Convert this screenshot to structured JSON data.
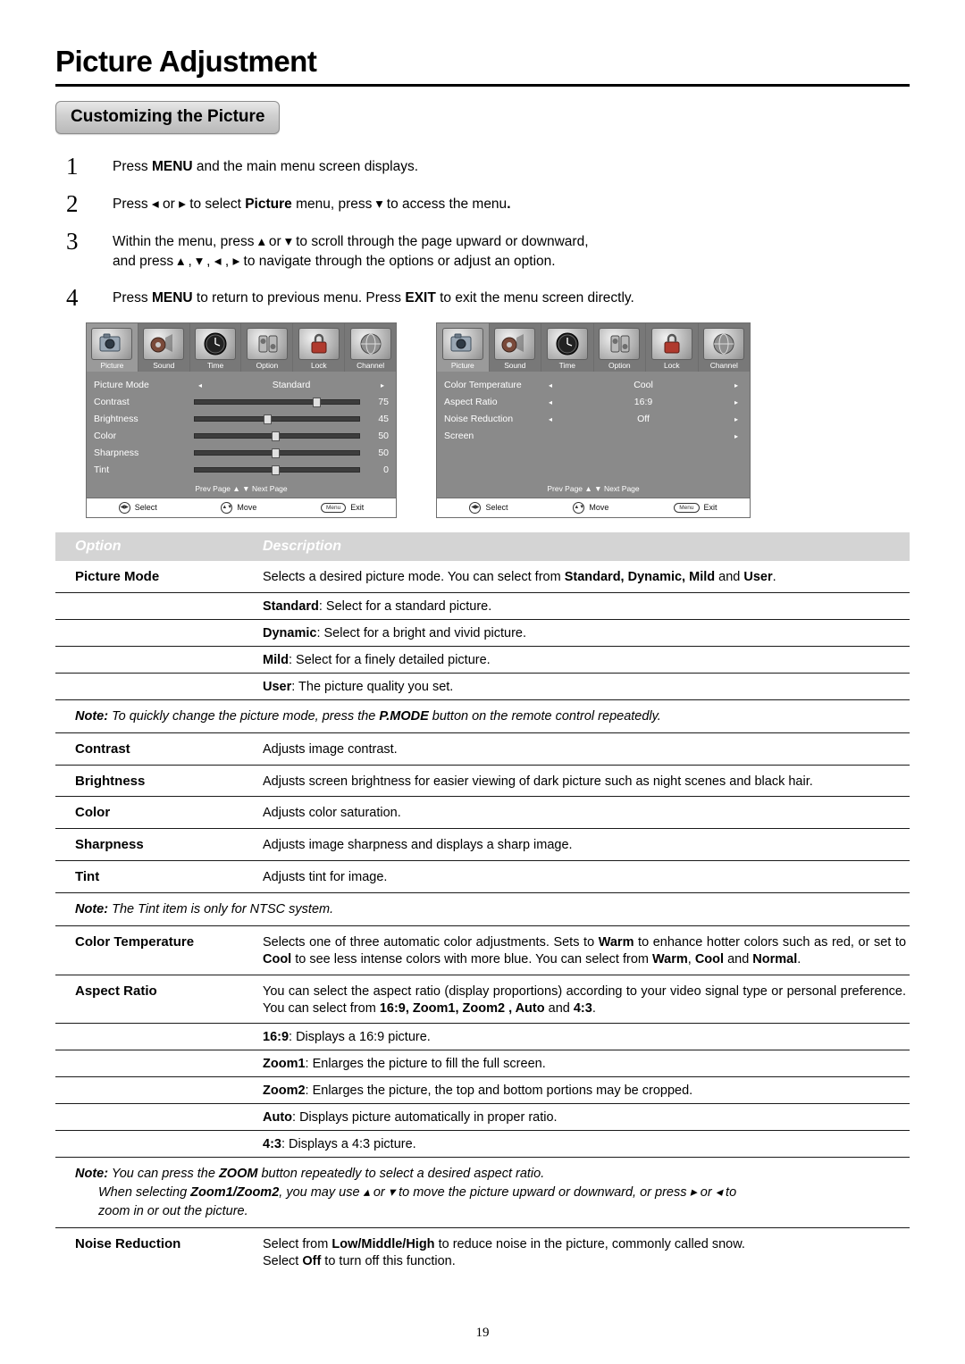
{
  "page": {
    "title": "Picture Adjustment",
    "section": "Customizing the Picture",
    "number": "19"
  },
  "steps": [
    {
      "num": "1",
      "html": "Press <b>MENU</b> and the main menu screen displays."
    },
    {
      "num": "2",
      "html": "Press ◂ or ▸ to select <b>Picture</b> menu,  press ▾ to access the menu<b>.</b>"
    },
    {
      "num": "3",
      "html": "Within the menu, press ▴ or ▾ to scroll through the page upward or downward,<br>and press ▴ , ▾ , ◂ , ▸ to navigate through the options or adjust an option."
    },
    {
      "num": "4",
      "html": "Press <b>MENU</b> to return to previous menu. Press <b>EXIT</b> to exit the menu screen directly."
    }
  ],
  "osd": {
    "tabs": [
      "Picture",
      "Sound",
      "Time",
      "Option",
      "Lock",
      "Channel"
    ],
    "left": {
      "rows": [
        {
          "type": "choice",
          "name": "Picture Mode",
          "value": "Standard"
        },
        {
          "type": "slider",
          "name": "Contrast",
          "value": "75",
          "pct": 75
        },
        {
          "type": "slider",
          "name": "Brightness",
          "value": "45",
          "pct": 45
        },
        {
          "type": "slider",
          "name": "Color",
          "value": "50",
          "pct": 50
        },
        {
          "type": "slider",
          "name": "Sharpness",
          "value": "50",
          "pct": 50
        },
        {
          "type": "slider",
          "name": "Tint",
          "value": "0",
          "pct": 50
        }
      ],
      "pager": "Prev Page ▲  ▼ Next Page"
    },
    "right": {
      "rows": [
        {
          "type": "choice",
          "name": "Color Temperature",
          "value": "Cool"
        },
        {
          "type": "choice",
          "name": "Aspect Ratio",
          "value": "16:9"
        },
        {
          "type": "choice",
          "name": "Noise Reduction",
          "value": "Off"
        },
        {
          "type": "arrow",
          "name": "Screen",
          "value": ""
        }
      ],
      "pager": "Prev Page ▲  ▼ Next Page"
    },
    "footer": {
      "select": "Select",
      "move": "Move",
      "exit": "Exit",
      "menu_key": "Menu"
    }
  },
  "table": {
    "header": {
      "option": "Option",
      "description": "Description"
    },
    "rows": [
      {
        "name": "Picture Mode",
        "desc": "Selects a desired picture mode. You can select from <b>Standard, Dynamic, Mild</b> and <b>User</b>.",
        "subs": [
          "<b>Standard</b>: Select for a standard picture.",
          "<b>Dynamic</b>: Select for a bright and vivid picture.",
          "<b>Mild</b>: Select for a finely detailed picture.",
          "<b>User</b>: The picture quality you set."
        ]
      },
      {
        "note": "<b>Note:</b> To quickly change the picture mode, press the <b>P.MODE</b> button on the remote control repeatedly."
      },
      {
        "name": "Contrast",
        "desc": "Adjusts image contrast.",
        "subs": []
      },
      {
        "name": "Brightness",
        "desc": "Adjusts screen brightness for easier viewing of dark picture such as night scenes and black hair.",
        "subs": []
      },
      {
        "name": "Color",
        "desc": "Adjusts color saturation.",
        "subs": []
      },
      {
        "name": "Sharpness",
        "desc": "Adjusts image sharpness and displays a sharp image.",
        "subs": []
      },
      {
        "name": "Tint",
        "desc": "Adjusts tint for image.",
        "subs": []
      },
      {
        "note": "<b>Note:</b> The Tint item is only for NTSC system."
      },
      {
        "name": "Color Temperature",
        "desc": "Selects one of three automatic color adjustments.  Sets to <b>Warm</b> to enhance hotter colors such as red,  or set to <b>Cool</b> to see less intense colors with more blue.  You can select from <b>Warm</b>, <b>Cool</b> and <b>Normal</b>.",
        "subs": []
      },
      {
        "name": "Aspect Ratio",
        "desc": "You can select the aspect ratio (display proportions) according to your video signal type or personal preference. You can select from <b>16:9,  Zoom1, Zoom2 , Auto</b> and <b>4:3</b>.",
        "subs": [
          "<b>16:9</b>: Displays a 16:9 picture.",
          "<b>Zoom1</b>: Enlarges the picture to fill the full screen.",
          "<b>Zoom2</b>: Enlarges the picture, the top and bottom portions may be cropped.",
          "<b>Auto</b>: Displays picture automatically in proper ratio.",
          "<b>4:3</b>: Displays a 4:3 picture."
        ]
      },
      {
        "note": "<b>Note:</b> You can press the <b>ZOOM</b> button repeatedly to select a desired aspect ratio.<br><span style=\"padding-left:26px;display:inline-block\">When selecting <b>Zoom1/Zoom2</b>, you may use ▴ or ▾ to move the picture upward or downward, or press ▸ or ◂ to</span><br><span style=\"padding-left:26px;display:inline-block\">zoom in or out the picture.</span>"
      },
      {
        "name": "Noise Reduction",
        "desc": "Select from <b>Low/Middle/High</b> to reduce noise in the picture, commonly called snow.<br>Select <b>Off</b> to turn off this function.",
        "subs": []
      }
    ]
  }
}
